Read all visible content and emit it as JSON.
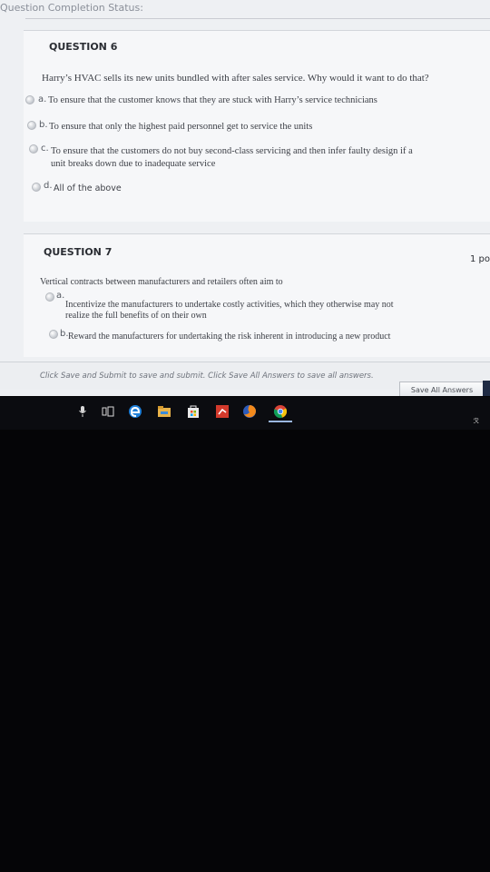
{
  "header": {
    "status_label": "Question Completion Status:"
  },
  "question6": {
    "heading": "QUESTION 6",
    "prompt": "Harry’s HVAC sells its new units bundled with after sales service. Why would it want to do that?",
    "options": [
      {
        "letter": "a.",
        "text": "To ensure that the customer knows that they are stuck with Harry’s service technicians"
      },
      {
        "letter": "b.",
        "text": "To ensure that only the highest paid personnel get to service the units"
      },
      {
        "letter": "c.",
        "line1": "To ensure that the customers do not buy second-class servicing and then infer faulty design if a",
        "line2": "unit breaks down due to inadequate service"
      },
      {
        "letter": "d.",
        "text": "All of the above"
      }
    ]
  },
  "question7": {
    "heading": "QUESTION 7",
    "points": "1 po",
    "prompt": "Vertical contracts between manufacturers and retailers often aim to",
    "options": [
      {
        "letter": "a.",
        "line1": "Incentivize the manufacturers to undertake costly activities, which they otherwise may not",
        "line2": "realize the full benefits of on their own"
      },
      {
        "letter": "b.",
        "text": "Reward the manufacturers for undertaking the risk inherent in introducing a new product"
      }
    ]
  },
  "footer": {
    "instructions": "Click Save and Submit to save and submit. Click Save All Answers to save all answers.",
    "save_all_label": "Save All Answers"
  },
  "taskbar": {
    "icons": [
      "mic-icon",
      "task-view-icon",
      "edge-icon",
      "file-explorer-icon",
      "store-icon",
      "app-icon",
      "firefox-icon",
      "chrome-icon"
    ],
    "tray_text": "ℛ"
  },
  "colors": {
    "screen_bg": "#eef0f3",
    "text": "#3a3d44",
    "taskbar": "#0b0c10",
    "desk": "#050507"
  }
}
